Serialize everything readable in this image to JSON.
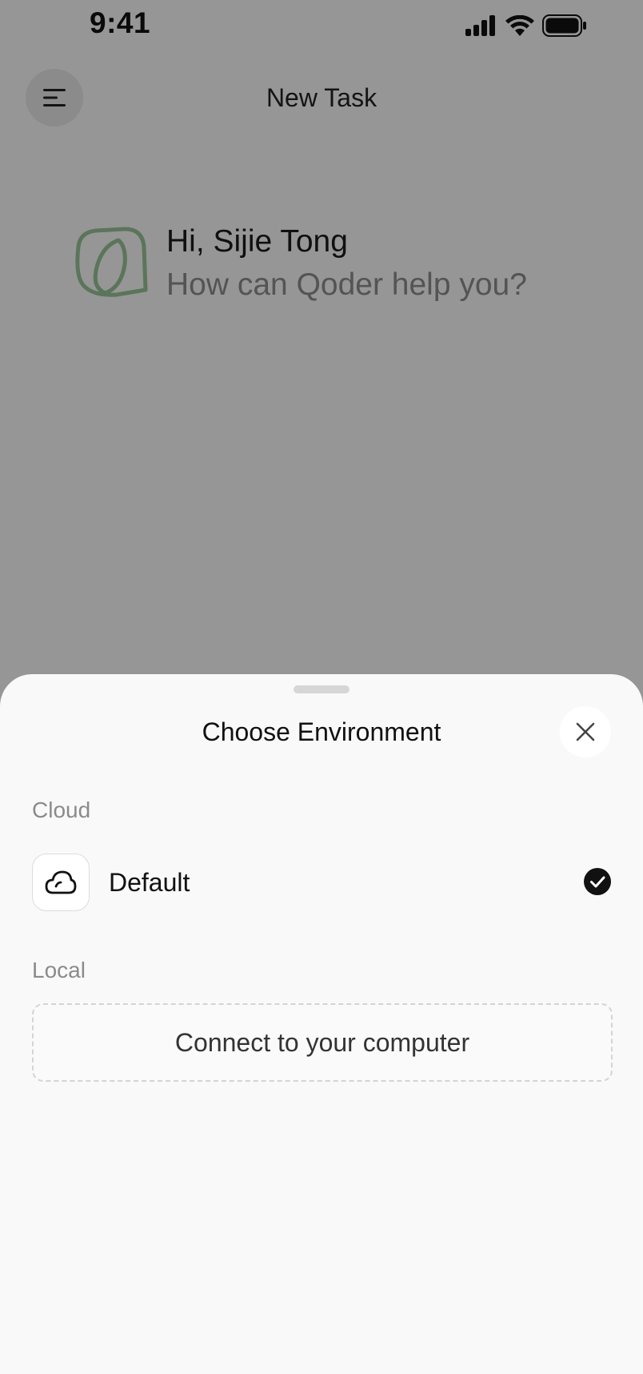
{
  "status_bar": {
    "time": "9:41"
  },
  "header": {
    "title": "New Task",
    "menu_icon": "menu-icon"
  },
  "greeting": {
    "line1": "Hi, Sijie Tong",
    "line2": "How can Qoder help you?"
  },
  "sheet": {
    "title": "Choose Environment",
    "close_icon": "close-icon",
    "cloud_section": {
      "label": "Cloud",
      "items": [
        {
          "label": "Default",
          "icon": "cloud-icon",
          "selected": true
        }
      ]
    },
    "local_section": {
      "label": "Local",
      "connect_label": "Connect to your computer"
    }
  },
  "colors": {
    "overlay": "#989898",
    "sheet_background": "#f9f9f9",
    "logo_accent": "#9bc79b",
    "check_fill": "#111111"
  }
}
